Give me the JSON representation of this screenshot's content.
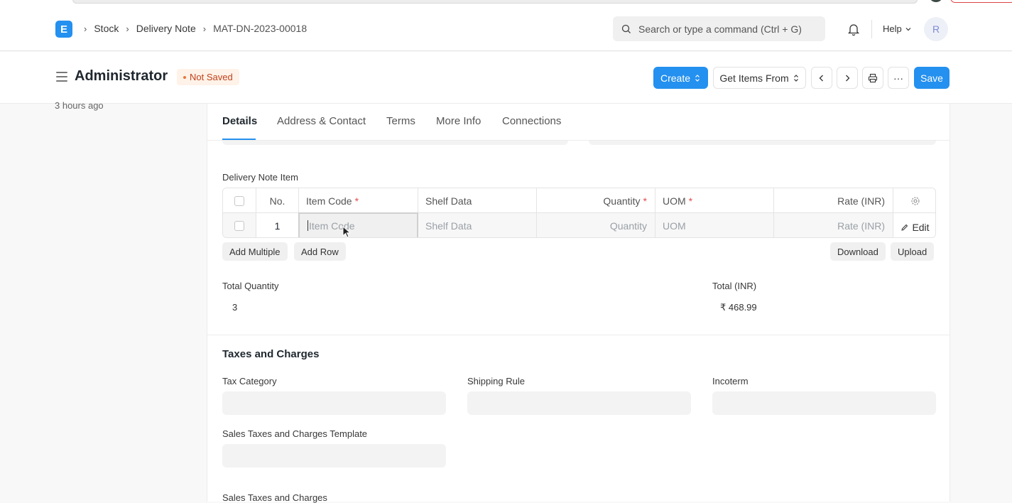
{
  "navbar": {
    "breadcrumbs": [
      "Stock",
      "Delivery Note",
      "MAT-DN-2023-00018"
    ],
    "search_placeholder": "Search or type a command (Ctrl + G)",
    "help_label": "Help",
    "avatar_initial": "R"
  },
  "header": {
    "title": "Administrator",
    "status": "Not Saved",
    "create_label": "Create",
    "get_items_label": "Get Items From",
    "save_label": "Save",
    "more_label": "···"
  },
  "sidebar": {
    "modified": "3 hours ago"
  },
  "tabs": [
    "Details",
    "Address & Contact",
    "Terms",
    "More Info",
    "Connections"
  ],
  "items_table": {
    "label": "Delivery Note Item",
    "columns": {
      "no": "No.",
      "item_code": "Item Code",
      "shelf_data": "Shelf Data",
      "quantity": "Quantity",
      "uom": "UOM",
      "rate": "Rate (INR)"
    },
    "row": {
      "no": "1",
      "item_code_placeholder": "Item Code",
      "shelf_data_placeholder": "Shelf Data",
      "quantity_placeholder": "Quantity",
      "uom_placeholder": "UOM",
      "rate_placeholder": "Rate (INR)",
      "edit_label": "Edit"
    },
    "buttons": {
      "add_multiple": "Add Multiple",
      "add_row": "Add Row",
      "download": "Download",
      "upload": "Upload"
    }
  },
  "totals": {
    "total_quantity_label": "Total Quantity",
    "total_quantity_value": "3",
    "total_label": "Total (INR)",
    "total_value": "₹ 468.99"
  },
  "taxes": {
    "section_title": "Taxes and Charges",
    "tax_category_label": "Tax Category",
    "shipping_rule_label": "Shipping Rule",
    "incoterm_label": "Incoterm",
    "template_label": "Sales Taxes and Charges Template",
    "next_label": "Sales Taxes and Charges"
  },
  "colors": {
    "primary": "#2490ef",
    "status_text": "#c0411d",
    "status_bg": "#fff2e8"
  }
}
